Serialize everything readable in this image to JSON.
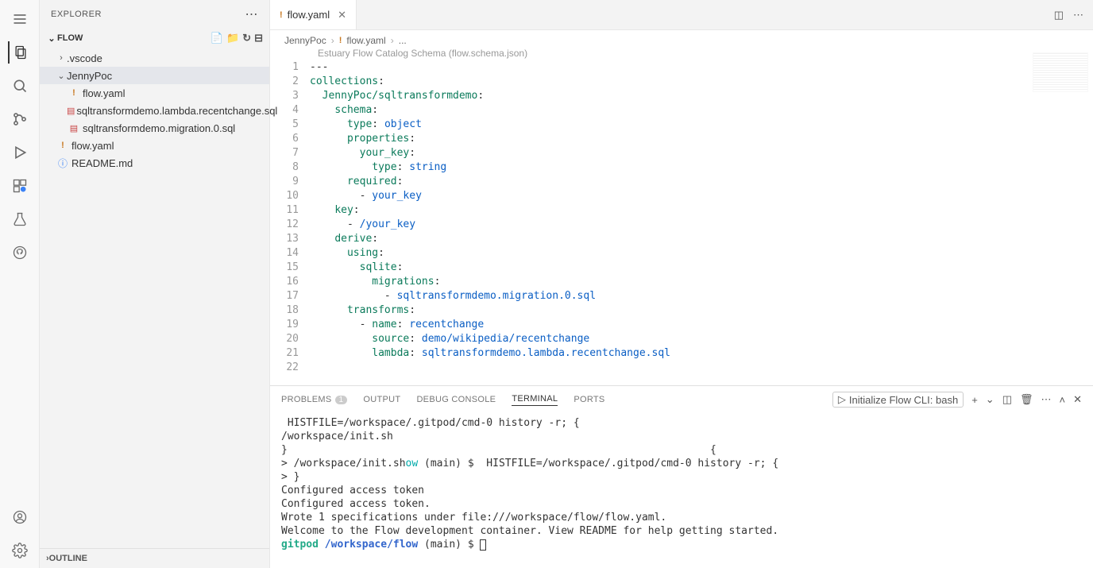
{
  "sidebar": {
    "title": "EXPLORER",
    "root": "FLOW",
    "tree": {
      "vscode": ".vscode",
      "jennypoc": "JennyPoc",
      "flow_yaml_inner": "flow.yaml",
      "sql_lambda": "sqltransformdemo.lambda.recentchange.sql",
      "sql_migration": "sqltransformdemo.migration.0.sql",
      "flow_yaml_outer": "flow.yaml",
      "readme": "README.md"
    },
    "outline": "OUTLINE"
  },
  "tabs": {
    "active": "flow.yaml"
  },
  "breadcrumb": {
    "p1": "JennyPoc",
    "p2": "flow.yaml",
    "p3": "..."
  },
  "schema_hint": "Estuary Flow Catalog Schema (flow.schema.json)",
  "code_lines": [
    {
      "n": 1,
      "html": "---"
    },
    {
      "n": 2,
      "html": "<span class='tk-key'>collections</span>:"
    },
    {
      "n": 3,
      "html": "  <span class='tk-key'>JennyPoc/sqltransformdemo</span>:"
    },
    {
      "n": 4,
      "html": "    <span class='tk-key'>schema</span>:"
    },
    {
      "n": 5,
      "html": "      <span class='tk-key'>type</span>: <span class='tk-str'>object</span>"
    },
    {
      "n": 6,
      "html": "      <span class='tk-key'>properties</span>:"
    },
    {
      "n": 7,
      "html": "        <span class='tk-key'>your_key</span>:"
    },
    {
      "n": 8,
      "html": "          <span class='tk-key'>type</span>: <span class='tk-str'>string</span>"
    },
    {
      "n": 9,
      "html": "      <span class='tk-key'>required</span>:"
    },
    {
      "n": 10,
      "html": "        - <span class='tk-str'>your_key</span>"
    },
    {
      "n": 11,
      "html": "    <span class='tk-key'>key</span>:"
    },
    {
      "n": 12,
      "html": "      - <span class='tk-str'>/your_key</span>"
    },
    {
      "n": 13,
      "html": "    <span class='tk-key'>derive</span>:"
    },
    {
      "n": 14,
      "html": "      <span class='tk-key'>using</span>:"
    },
    {
      "n": 15,
      "html": "        <span class='tk-key'>sqlite</span>:"
    },
    {
      "n": 16,
      "html": "          <span class='tk-key'>migrations</span>:"
    },
    {
      "n": 17,
      "html": "            - <span class='tk-str'>sqltransformdemo.migration.0.sql</span>"
    },
    {
      "n": 18,
      "html": "      <span class='tk-key'>transforms</span>:"
    },
    {
      "n": 19,
      "html": "        - <span class='tk-key'>name</span>: <span class='tk-str'>recentchange</span>"
    },
    {
      "n": 20,
      "html": "          <span class='tk-key'>source</span>: <span class='tk-str'>demo/wikipedia/recentchange</span>"
    },
    {
      "n": 21,
      "html": "          <span class='tk-key'>lambda</span>: <span class='tk-str'>sqltransformdemo.lambda.recentchange.sql</span>"
    },
    {
      "n": 22,
      "html": ""
    }
  ],
  "panel": {
    "tabs": {
      "problems": "PROBLEMS",
      "problems_count": "1",
      "output": "OUTPUT",
      "debug": "DEBUG CONSOLE",
      "terminal": "TERMINAL",
      "ports": "PORTS"
    },
    "task_label": "Initialize Flow CLI: bash"
  },
  "terminal_lines": [
    {
      "html": " HISTFILE=/workspace/.gitpod/cmd-0 history -r; {"
    },
    {
      "html": "/workspace/init.sh"
    },
    {
      "html": "}                                                                    {"
    },
    {
      "html": "> /workspace/init.sh<span class='term-cyan'>ow</span> (main) $  HISTFILE=/workspace/.gitpod/cmd-0 history -r; {"
    },
    {
      "html": "> }"
    },
    {
      "html": "Configured access token"
    },
    {
      "html": "Configured access token."
    },
    {
      "html": "Wrote 1 specifications under file:///workspace/flow/flow.yaml."
    },
    {
      "html": "Welcome to the Flow development container. View README for help getting started."
    },
    {
      "html": "<span class='term-green-bold'>gitpod</span> <span class='term-blue-bold'>/workspace/flow</span> (main) $ <span class='cursor-block'></span>"
    }
  ]
}
